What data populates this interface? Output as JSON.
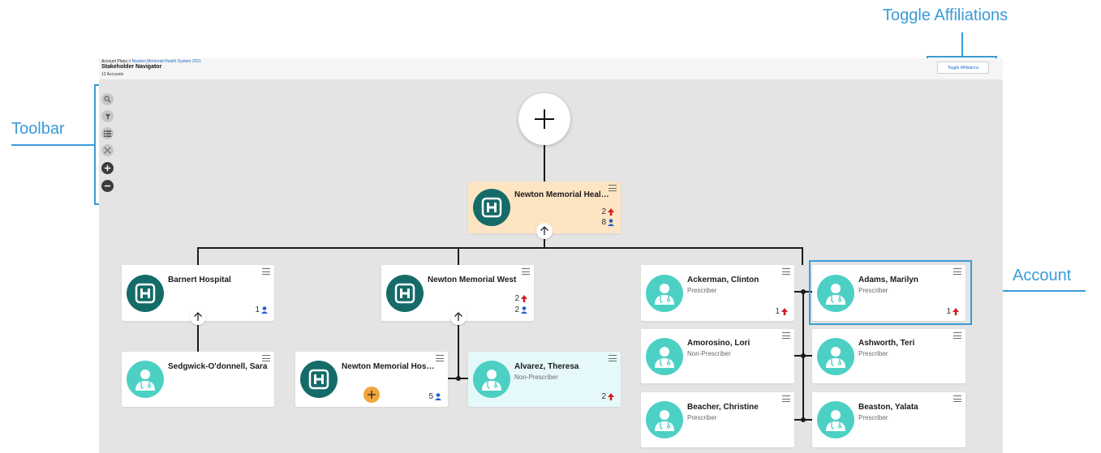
{
  "annotations": {
    "toggle_affiliations": "Toggle Affiliations",
    "toolbar": "Toolbar",
    "account": "Account"
  },
  "header": {
    "breadcrumb_root": "Account Plans >",
    "breadcrumb_link": "Newton Memorial Health System 2021",
    "title": "Stakeholder Navigator",
    "subtitle": "12 Accounts",
    "toggle_button": "Toggle Affiliations"
  },
  "toolbar": {
    "icons": [
      "search-icon",
      "filter-icon",
      "list-icon",
      "fit-to-screen-icon",
      "zoom-in-icon",
      "zoom-out-icon"
    ]
  },
  "colors": {
    "annotation": "#3a9bd8",
    "hospital_avatar": "#146b68",
    "person_avatar": "#4dd0c4",
    "root_card": "#fde4c3",
    "highlight_card": "#e6f9fa",
    "add_button": "#f3a43a",
    "up_arrow": "#d42020",
    "person_count": "#1f5fd0"
  },
  "cards": {
    "root": {
      "name": "Newton Memorial Health...",
      "up_count": "2",
      "people_count": "8"
    },
    "barnert": {
      "name": "Barnert Hospital",
      "people_count": "1"
    },
    "nm_west": {
      "name": "Newton Memorial West",
      "up_count": "2",
      "people_count": "2"
    },
    "sedgwick": {
      "name": "Sedgwick-O'donnell, Sara"
    },
    "nm_hospi": {
      "name": "Newton Memorial Hospi...",
      "people_count": "5"
    },
    "alvarez": {
      "name": "Alvarez, Theresa",
      "type": "Non-Prescriber",
      "up_count": "2"
    },
    "ackerman": {
      "name": "Ackerman, Clinton",
      "type": "Prescriber",
      "up_count": "1"
    },
    "adams": {
      "name": "Adams, Marilyn",
      "type": "Prescriber",
      "up_count": "1"
    },
    "amorosino": {
      "name": "Amorosino, Lori",
      "type": "Non-Prescriber"
    },
    "ashworth": {
      "name": "Ashworth, Teri",
      "type": "Prescriber"
    },
    "beacher": {
      "name": "Beacher, Christine",
      "type": "Prescriber"
    },
    "beaston": {
      "name": "Beaston, Yalata",
      "type": "Prescriber"
    }
  }
}
